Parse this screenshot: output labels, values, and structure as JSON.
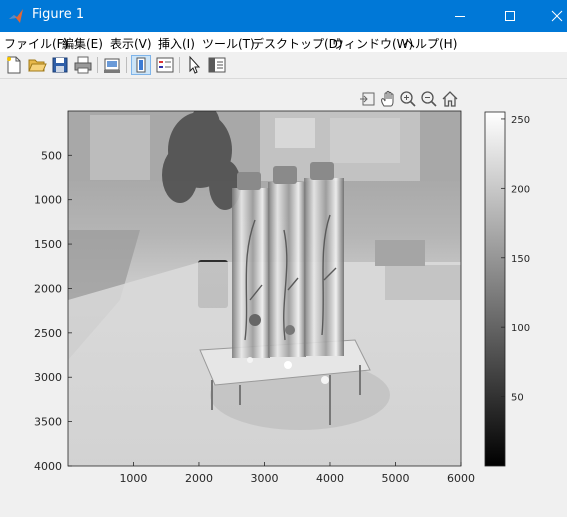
{
  "window": {
    "title": "Figure 1"
  },
  "menu": {
    "items": [
      "ファイル(F)",
      "編集(E)",
      "表示(V)",
      "挿入(I)",
      "ツール(T)",
      "デスクトップ(D)",
      "ウィンドウ(W)",
      "ヘルプ(H)"
    ]
  },
  "toolbar": {
    "buttons": [
      "new-figure-icon",
      "open-file-icon",
      "save-icon",
      "print-icon",
      "link-plot-icon",
      "colorbar-toggle-icon",
      "legend-toggle-icon",
      "edit-pointer-icon",
      "property-inspector-icon"
    ]
  },
  "axes_toolbar": {
    "buttons": [
      "export-icon",
      "pan-icon",
      "zoom-in-icon",
      "zoom-out-icon",
      "home-icon"
    ]
  },
  "image_content": {
    "description_kind": "grayscale photo of three glass bottles with dried plants on an acrylic stand",
    "colormap": "gray"
  },
  "chart_data": {
    "type": "heatmap",
    "xlim": [
      1,
      6000
    ],
    "ylim": [
      1,
      4000
    ],
    "y_reversed": true,
    "xticks": [
      1000,
      2000,
      3000,
      4000,
      5000,
      6000
    ],
    "yticks": [
      500,
      1000,
      1500,
      2000,
      2500,
      3000,
      3500,
      4000
    ],
    "xtick_labels": [
      "1000",
      "2000",
      "3000",
      "4000",
      "5000",
      "6000"
    ],
    "ytick_labels": [
      "500",
      "1000",
      "1500",
      "2000",
      "2500",
      "3000",
      "3500",
      "4000"
    ],
    "colorbar": {
      "range": [
        0,
        255
      ],
      "ticks": [
        50,
        100,
        150,
        200,
        250
      ],
      "tick_labels": [
        "50",
        "100",
        "150",
        "200",
        "250"
      ]
    }
  },
  "colors": {
    "titlebar": "#0078d7",
    "menubar": "#ffffff",
    "figure_bg": "#f0f0f0"
  }
}
